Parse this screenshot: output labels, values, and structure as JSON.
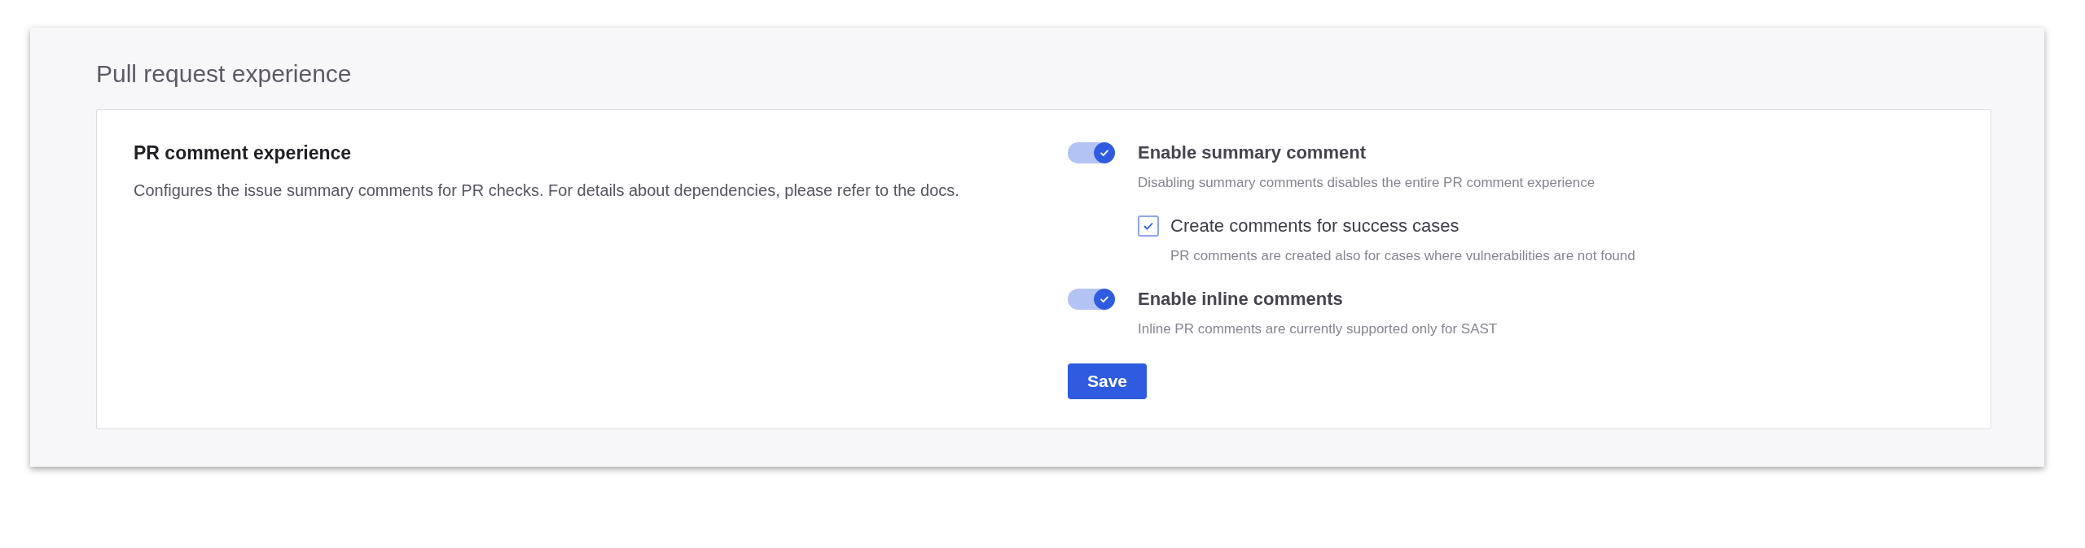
{
  "section": {
    "title": "Pull request experience"
  },
  "card": {
    "heading": "PR comment experience",
    "description": "Configures the issue summary comments for PR checks. For details about dependencies, please refer to the docs.",
    "options": [
      {
        "kind": "toggle",
        "label": "Enable summary comment",
        "hint": "Disabling summary comments disables the entire PR comment experience",
        "on": true,
        "children": [
          {
            "kind": "checkbox",
            "label": "Create comments for success cases",
            "hint": "PR comments are created also for cases where vulnerabilities are not found",
            "checked": true
          }
        ]
      },
      {
        "kind": "toggle",
        "label": "Enable inline comments",
        "hint": "Inline PR comments are currently supported only for SAST",
        "on": true
      }
    ],
    "button": "Save"
  }
}
